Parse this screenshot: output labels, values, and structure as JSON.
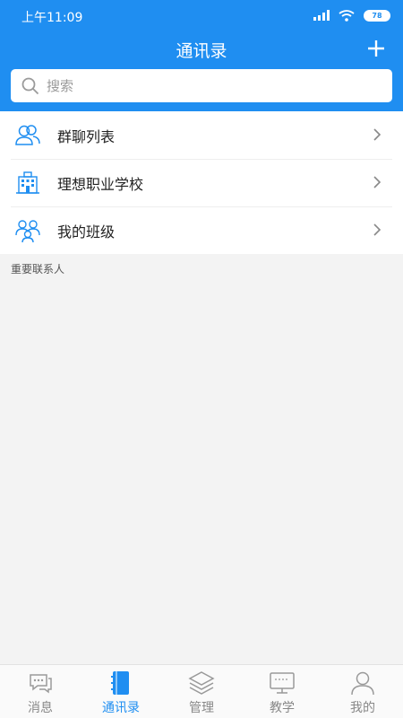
{
  "status_bar": {
    "time": "上午11:09",
    "battery": "78"
  },
  "header": {
    "title": "通讯录"
  },
  "search": {
    "placeholder": "搜索"
  },
  "list": [
    {
      "label": "群聊列表",
      "icon": "group-chat-icon"
    },
    {
      "label": "理想职业学校",
      "icon": "school-building-icon"
    },
    {
      "label": "我的班级",
      "icon": "class-people-icon"
    }
  ],
  "section_title": "重要联系人",
  "tabs": [
    {
      "label": "消息",
      "icon": "message-icon",
      "active": false
    },
    {
      "label": "通讯录",
      "icon": "contacts-book-icon",
      "active": true
    },
    {
      "label": "管理",
      "icon": "layers-icon",
      "active": false
    },
    {
      "label": "教学",
      "icon": "teaching-icon",
      "active": false
    },
    {
      "label": "我的",
      "icon": "profile-icon",
      "active": false
    }
  ],
  "colors": {
    "primary": "#1f8ef1",
    "tab_inactive": "#888888",
    "background": "#f3f3f3"
  }
}
